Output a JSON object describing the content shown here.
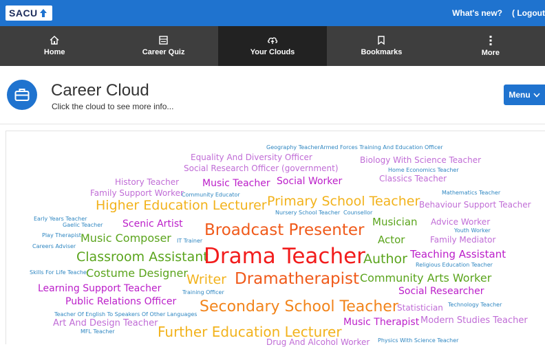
{
  "topbar": {
    "logo_text": "SACU",
    "whats_new": "What's new?",
    "logout": "( Logout"
  },
  "nav": [
    {
      "label": "Home",
      "icon": "home-icon"
    },
    {
      "label": "Career Quiz",
      "icon": "quiz-icon"
    },
    {
      "label": "Your Clouds",
      "icon": "cloud-icon"
    },
    {
      "label": "Bookmarks",
      "icon": "bookmark-icon"
    },
    {
      "label": "More",
      "icon": "more-icon"
    }
  ],
  "header": {
    "title": "Career Cloud",
    "subtitle": "Click the cloud to see more info...",
    "menu_label": "Menu"
  },
  "colors": {
    "brand_blue": "#1f73cf",
    "nav_dark": "#3e3e3e",
    "nav_active": "#222222"
  },
  "cloud": [
    {
      "text": "Geography Teacher",
      "color": "#2e86c1"
    },
    {
      "text": "Armed Forces Training And Education Officer",
      "color": "#2e86c1"
    },
    {
      "text": "Equality And Diversity Officer",
      "color": "#c06cd6"
    },
    {
      "text": "Biology With Science Teacher",
      "color": "#c06cd6"
    },
    {
      "text": "Social Research Officer (government)",
      "color": "#c06cd6"
    },
    {
      "text": "Home Economics Teacher",
      "color": "#2e86c1"
    },
    {
      "text": "History Teacher",
      "color": "#c06cd6"
    },
    {
      "text": "Music Teacher",
      "color": "#bb1ec9"
    },
    {
      "text": "Social Worker",
      "color": "#bb1ec9"
    },
    {
      "text": "Classics Teacher",
      "color": "#c06cd6"
    },
    {
      "text": "Family Support Worker",
      "color": "#c06cd6"
    },
    {
      "text": "Community Educator",
      "color": "#2e86c1"
    },
    {
      "text": "Mathematics Teacher",
      "color": "#2e86c1"
    },
    {
      "text": "Higher Education Lecturer",
      "color": "#f2b21b"
    },
    {
      "text": "Primary School Teacher",
      "color": "#f2b21b"
    },
    {
      "text": "Behaviour Support Teacher",
      "color": "#c06cd6"
    },
    {
      "text": "Nursery School Teacher",
      "color": "#2e86c1"
    },
    {
      "text": "Counsellor",
      "color": "#2e86c1"
    },
    {
      "text": "Early Years Teacher",
      "color": "#2e86c1"
    },
    {
      "text": "Gaelic Teacher",
      "color": "#2e86c1"
    },
    {
      "text": "Scenic Artist",
      "color": "#bb1ec9"
    },
    {
      "text": "Musician",
      "color": "#5aa41c"
    },
    {
      "text": "Advice Worker",
      "color": "#c06cd6"
    },
    {
      "text": "Broadcast Presenter",
      "color": "#f05a1a"
    },
    {
      "text": "Youth Worker",
      "color": "#2e86c1"
    },
    {
      "text": "Play Therapist",
      "color": "#2e86c1"
    },
    {
      "text": "Music Composer",
      "color": "#5aa41c"
    },
    {
      "text": "IT Trainer",
      "color": "#2e86c1"
    },
    {
      "text": "Actor",
      "color": "#5aa41c"
    },
    {
      "text": "Family Mediator",
      "color": "#c06cd6"
    },
    {
      "text": "Careers Adviser",
      "color": "#2e86c1"
    },
    {
      "text": "Classroom Assistant",
      "color": "#5aa41c"
    },
    {
      "text": "Drama Teacher",
      "color": "#f21c1c"
    },
    {
      "text": "Author",
      "color": "#5aa41c"
    },
    {
      "text": "Teaching Assistant",
      "color": "#bb1ec9"
    },
    {
      "text": "Religious Education Teacher",
      "color": "#2e86c1"
    },
    {
      "text": "Skills For Life Teacher",
      "color": "#2e86c1"
    },
    {
      "text": "Costume Designer",
      "color": "#5aa41c"
    },
    {
      "text": "Writer",
      "color": "#f2b21b"
    },
    {
      "text": "Dramatherapist",
      "color": "#f05a1a"
    },
    {
      "text": "Community Arts Worker",
      "color": "#5aa41c"
    },
    {
      "text": "Learning Support Teacher",
      "color": "#bb1ec9"
    },
    {
      "text": "Training Officer",
      "color": "#2e86c1"
    },
    {
      "text": "Social Researcher",
      "color": "#bb1ec9"
    },
    {
      "text": "Public Relations Officer",
      "color": "#bb1ec9"
    },
    {
      "text": "Secondary School Teacher",
      "color": "#f2841b"
    },
    {
      "text": "Statistician",
      "color": "#c06cd6"
    },
    {
      "text": "Technology Teacher",
      "color": "#2e86c1"
    },
    {
      "text": "Teacher Of English To Speakers Of Other Languages",
      "color": "#2e86c1"
    },
    {
      "text": "Art And Design Teacher",
      "color": "#c06cd6"
    },
    {
      "text": "Music Therapist",
      "color": "#bb1ec9"
    },
    {
      "text": "Modern Studies Teacher",
      "color": "#c06cd6"
    },
    {
      "text": "MFL Teacher",
      "color": "#2e86c1"
    },
    {
      "text": "Further Education Lecturer",
      "color": "#f2b21b"
    },
    {
      "text": "Drug And Alcohol Worker",
      "color": "#c06cd6"
    },
    {
      "text": "Physics With Science Teacher",
      "color": "#2e86c1"
    }
  ]
}
